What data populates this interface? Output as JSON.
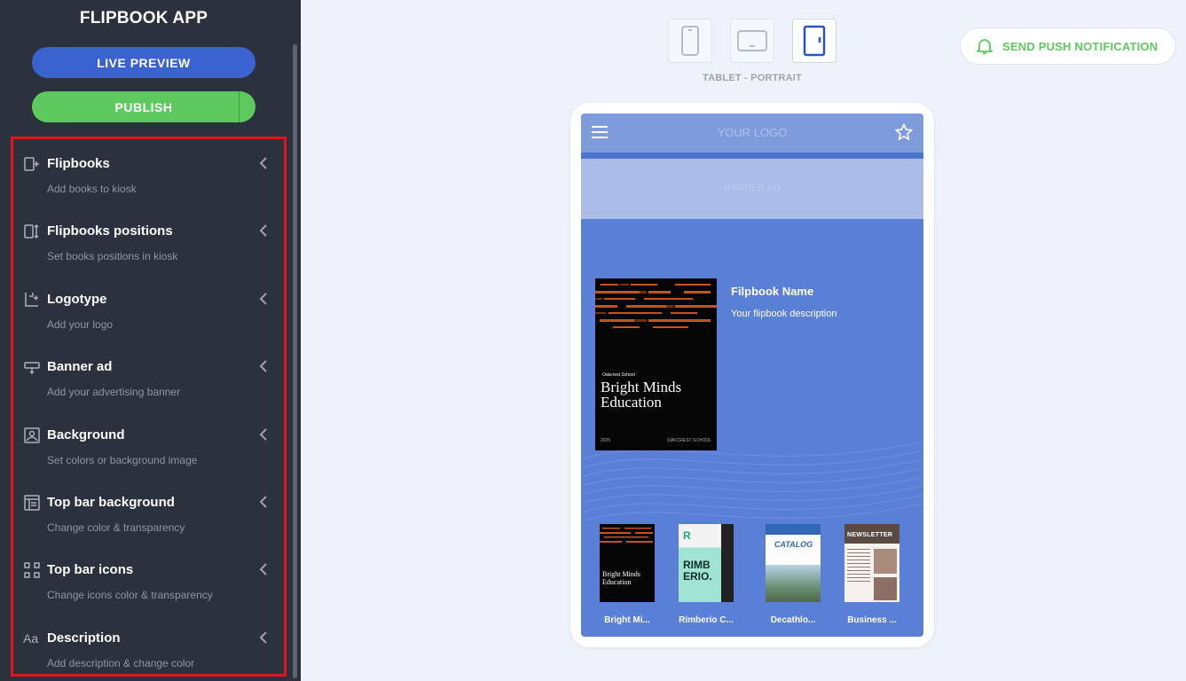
{
  "app": {
    "title": "FLIPBOOK APP"
  },
  "actions": {
    "live_preview": "LIVE PREVIEW",
    "publish": "PUBLISH"
  },
  "menu": [
    {
      "icon": "add-book-icon",
      "title": "Flipbooks",
      "subtitle": "Add books to kiosk"
    },
    {
      "icon": "positions-icon",
      "title": "Flipbooks positions",
      "subtitle": "Set books positions in kiosk"
    },
    {
      "icon": "logotype-icon",
      "title": "Logotype",
      "subtitle": "Add your logo"
    },
    {
      "icon": "banner-icon",
      "title": "Banner ad",
      "subtitle": "Add your advertising banner"
    },
    {
      "icon": "image-icon",
      "title": "Background",
      "subtitle": "Set colors or background image"
    },
    {
      "icon": "layout-icon",
      "title": "Top bar background",
      "subtitle": "Change color & transparency"
    },
    {
      "icon": "grid-icon",
      "title": "Top bar icons",
      "subtitle": "Change icons color & transparency"
    },
    {
      "icon": "text-size-icon",
      "title": "Description",
      "subtitle": "Add description & change color"
    }
  ],
  "device": {
    "options": [
      "phone",
      "tablet-landscape",
      "tablet-portrait"
    ],
    "selected": "tablet-portrait",
    "label": "TABLET - PORTRAIT"
  },
  "push": {
    "label": "SEND PUSH NOTIFICATION"
  },
  "preview": {
    "logo": "YOUR LOGO",
    "banner": "BANNER AD",
    "featured": {
      "name": "Filpbook Name",
      "description": "Your flipbook description",
      "cover": {
        "school": "Oakcrest School",
        "title_line1": "Bright Minds",
        "title_line2": "Education",
        "year": "2025",
        "footer": "OAKCREST SCHOOL"
      }
    },
    "books": [
      {
        "label": "Bright Mi...",
        "cover_title": "Bright Minds Education"
      },
      {
        "label": "Rimberio C...",
        "cover_title": "RIMBERIO."
      },
      {
        "label": "Decathlo...",
        "cover_title": "CATALOG"
      },
      {
        "label": "Business ...",
        "cover_title": "NEWSLETTER"
      }
    ]
  },
  "colors": {
    "sidebar_bg": "#2b323d",
    "live_preview": "#3a63d0",
    "publish": "#5ec95e",
    "highlight_border": "#e0161e",
    "screen_bg": "#5a7fd6",
    "accent_green": "#5ec95e",
    "active_device": "#2d54b7"
  }
}
